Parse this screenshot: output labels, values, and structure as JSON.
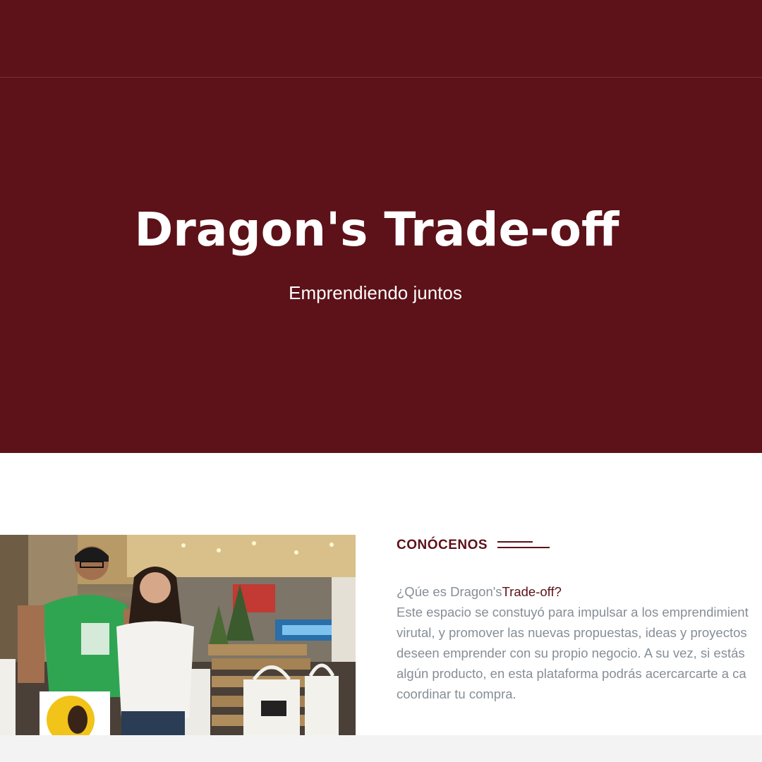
{
  "colors": {
    "brand": "#5d1118",
    "body_text": "#868e96",
    "footer_band": "#f3f3f3"
  },
  "hero": {
    "title": "Dragon's Trade-off",
    "subtitle": "Emprendiendo juntos"
  },
  "about": {
    "label": "CONÓCENOS",
    "question_prefix": "¿Qúe es Dragon's",
    "question_accent": "Trade-off?",
    "lines": [
      "Este espacio se constuyó para impulsar a los emprendimient",
      "virutal, y promover las nuevas propuestas, ideas y proyectos",
      "deseen emprender con su propio negocio. A su vez, si estás",
      "algún producto, en esta plataforma podrás acercarcarte a ca",
      "coordinar tu compra."
    ],
    "photo_icon": "photo-two-people-at-market-stall"
  }
}
